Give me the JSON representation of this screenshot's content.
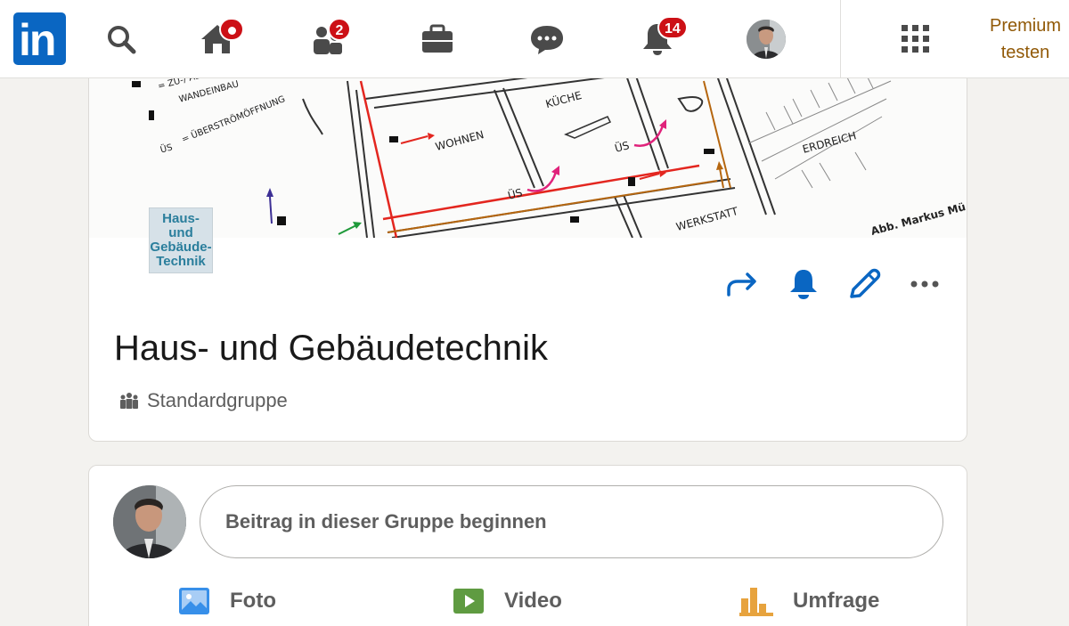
{
  "nav": {
    "logo_text": "in",
    "items": [
      {
        "name": "search",
        "icon": "search-icon"
      },
      {
        "name": "home",
        "icon": "home-icon",
        "badge": ""
      },
      {
        "name": "network",
        "icon": "network-icon",
        "badge": "2"
      },
      {
        "name": "jobs",
        "icon": "briefcase-icon"
      },
      {
        "name": "messaging",
        "icon": "chat-icon"
      },
      {
        "name": "notifications",
        "icon": "bell-icon",
        "badge": "14"
      },
      {
        "name": "me",
        "icon": "avatar"
      },
      {
        "name": "work",
        "icon": "grid-icon"
      }
    ],
    "premium_line1": "Premium",
    "premium_line2": "testen"
  },
  "group": {
    "cover_labels": {
      "zu_abluft": "= ZU-/ ABLUFTVE",
      "wandeinbau": "WANDEINBAU",
      "us": "ÜS",
      "uberstrom": "= ÜBERSTRÖMÖFFNUNG",
      "wohnen": "WOHNEN",
      "kuche": "KÜCHE",
      "us2": "ÜS",
      "us3": "ÜS",
      "erdreich": "ERDREICH",
      "werkstatt": "WERKSTATT",
      "credit": "Abb. Markus Mü"
    },
    "logo_lines": [
      "Haus-",
      "und",
      "Gebäude-",
      "Technik"
    ],
    "title": "Haus- und Gebäudetechnik",
    "type": "Standardgruppe"
  },
  "post": {
    "placeholder": "Beitrag in dieser Gruppe beginnen",
    "actions": [
      {
        "label": "Foto",
        "icon": "photo-icon",
        "color": "#378fe9"
      },
      {
        "label": "Video",
        "icon": "video-icon",
        "color": "#5f9b41"
      },
      {
        "label": "Umfrage",
        "icon": "poll-icon",
        "color": "#e7a33e"
      }
    ]
  },
  "colors": {
    "brand": "#0a66c2",
    "badge": "#cc1016",
    "premium": "#915907"
  }
}
